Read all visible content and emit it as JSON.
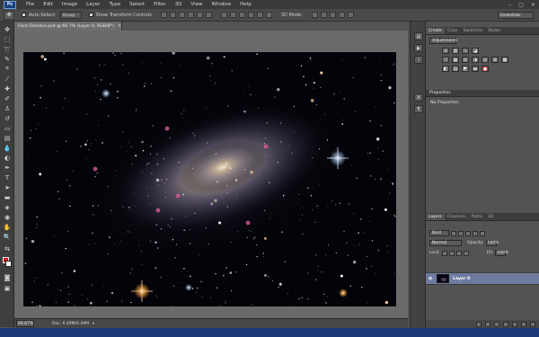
{
  "app": {
    "logo_text": "Ps"
  },
  "menu": {
    "items": [
      "File",
      "Edit",
      "Image",
      "Layer",
      "Type",
      "Select",
      "Filter",
      "3D",
      "View",
      "Window",
      "Help"
    ]
  },
  "options_bar": {
    "auto_select_label": "Auto-Select:",
    "auto_select_value": "Group",
    "transform_label": "Show Transform Controls",
    "mode_3d_label": "3D Mode:",
    "workspace": "Essentials"
  },
  "document": {
    "tab_title": "Face Dissolve.psd @ 66.7% (Layer 0, RGB/8*)",
    "close_glyph": "×"
  },
  "status": {
    "zoom": "66.67%",
    "doc_size": "Doc: 6.49M/6.49M"
  },
  "panels": {
    "top_tabs": [
      {
        "label": "Create",
        "active": true
      },
      {
        "label": "Color",
        "active": false
      },
      {
        "label": "Swatches",
        "active": false
      },
      {
        "label": "Styles",
        "active": false
      }
    ],
    "adjustments_dropdown": "Adjustments",
    "properties": {
      "title": "Properties",
      "empty_text": "No Properties"
    },
    "layers_tabs": [
      {
        "label": "Layers",
        "active": true
      },
      {
        "label": "Channels",
        "active": false
      },
      {
        "label": "Paths",
        "active": false
      },
      {
        "label": "3D",
        "active": false
      }
    ],
    "layers": {
      "filter_kind": "Kind",
      "blend_mode": "Normal",
      "opacity_label": "Opacity:",
      "opacity_value": "100%",
      "lock_label": "Lock:",
      "fill_label": "Fill:",
      "fill_value": "100%",
      "layer_name": "Layer 0"
    }
  },
  "colors": {
    "foreground": "#d6171e",
    "background": "#ffffff",
    "selection_blue": "#6f7aa0"
  }
}
